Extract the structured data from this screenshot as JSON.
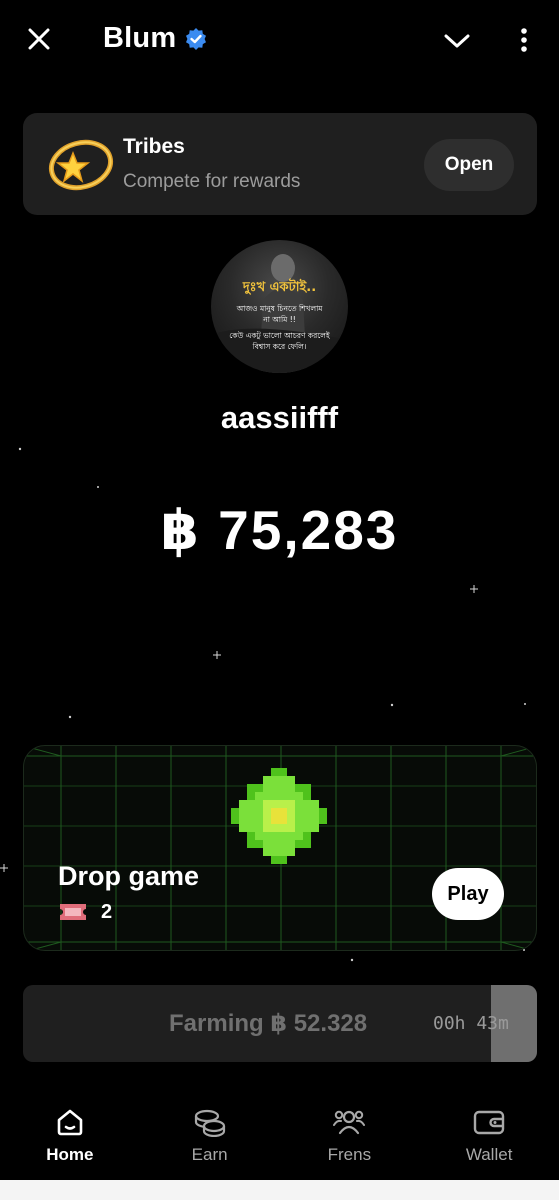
{
  "header": {
    "title": "Blum",
    "close_icon": "close-icon",
    "verified_icon": "verified-badge-icon",
    "chevron_icon": "chevron-down-icon",
    "more_icon": "more-vertical-icon"
  },
  "tribes": {
    "title": "Tribes",
    "subtitle": "Compete for rewards",
    "button": "Open",
    "icon": "shooting-star-ring-icon"
  },
  "profile": {
    "avatar_lines": [
      "দুঃখ একটাই..",
      "আজও মানুষ চিনতে শিখলাম",
      "না আমি !!",
      "কেউ একটু ভালো আচরণ করলেই",
      "বিশ্বাস করে ফেলি।"
    ],
    "username": "aassiifff",
    "balance": "฿ 75,283"
  },
  "drop_game": {
    "title": "Drop game",
    "tickets": "2",
    "ticket_icon": "ticket-icon",
    "button": "Play",
    "graphic": "green-pixel-star-icon"
  },
  "farming": {
    "label": "Farming ฿ 52.328",
    "time": "00h 43m",
    "progress_fraction": 0.09
  },
  "nav": {
    "items": [
      {
        "label": "Home",
        "icon": "home-icon",
        "active": true
      },
      {
        "label": "Earn",
        "icon": "coins-icon",
        "active": false
      },
      {
        "label": "Frens",
        "icon": "friends-icon",
        "active": false
      },
      {
        "label": "Wallet",
        "icon": "wallet-icon",
        "active": false
      }
    ]
  },
  "colors": {
    "background": "#000000",
    "card": "#1f1f1f",
    "accent_green": "#7be03a",
    "verified_blue": "#3b8bf0"
  }
}
